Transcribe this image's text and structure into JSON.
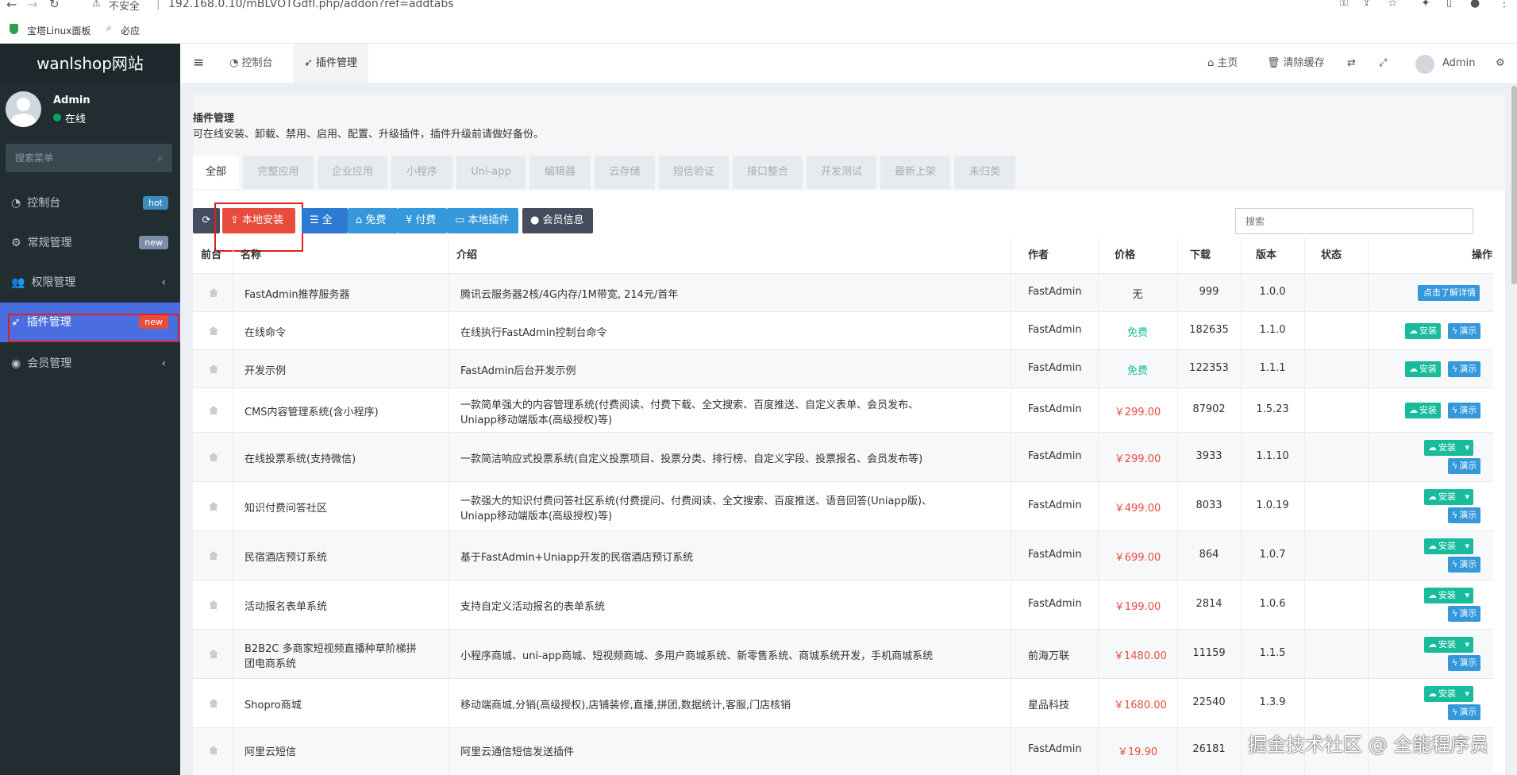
{
  "browser": {
    "security": "不安全",
    "url": "192.168.0.10/mBLVOTGdfl.php/addon?ref=addtabs",
    "bookmarks": [
      "宝塔Linux面板",
      "必应"
    ]
  },
  "sidebar": {
    "brand": "wanlshop网站",
    "user_name": "Admin",
    "status": "在线",
    "search_placeholder": "搜索菜单",
    "items": [
      {
        "label": "控制台",
        "badge": "hot"
      },
      {
        "label": "常规管理",
        "badge": "new"
      },
      {
        "label": "权限管理",
        "badge": ""
      },
      {
        "label": "插件管理",
        "badge": "new"
      },
      {
        "label": "会员管理",
        "badge": ""
      }
    ]
  },
  "header": {
    "tabs": [
      "控制台",
      "插件管理"
    ],
    "home": "主页",
    "clear_cache": "清除缓存",
    "user": "Admin"
  },
  "panel": {
    "title": "插件管理",
    "description": "可在线安装、卸载、禁用、启用、配置、升级插件，插件升级前请做好备份。",
    "categories": [
      "全部",
      "完整应用",
      "企业应用",
      "小程序",
      "Uni-app",
      "编辑器",
      "云存储",
      "短信验证",
      "接口整合",
      "开发测试",
      "最新上架",
      "未归类"
    ],
    "toolbar": {
      "local_install": "本地安装",
      "all": "全部",
      "free": "免费",
      "paid": "付费",
      "local_plugins": "本地插件",
      "member_info": "会员信息",
      "search_placeholder": "搜索"
    },
    "columns": [
      "前台",
      "名称",
      "介绍",
      "作者",
      "价格",
      "下载",
      "版本",
      "状态",
      "操作"
    ],
    "action_labels": {
      "install": "安装",
      "demo": "演示",
      "details": "点击了解详情"
    },
    "rows": [
      {
        "name": "FastAdmin推荐服务器",
        "intro": "腾讯云服务器2核/4G内存/1M带宽, 214元/首年",
        "author": "FastAdmin",
        "price": "无",
        "downloads": "999",
        "version": "1.0.0",
        "action": "details"
      },
      {
        "name": "在线命令",
        "intro": "在线执行FastAdmin控制台命令",
        "author": "FastAdmin",
        "price": "免费",
        "downloads": "182635",
        "version": "1.1.0",
        "action": "inline"
      },
      {
        "name": "开发示例",
        "intro": "FastAdmin后台开发示例",
        "author": "FastAdmin",
        "price": "免费",
        "downloads": "122353",
        "version": "1.1.1",
        "action": "inline"
      },
      {
        "name": "CMS内容管理系统(含小程序)",
        "intro": "一款简单强大的内容管理系统(付费阅读、付费下载、全文搜索、百度推送、自定义表单、会员发布、",
        "intro2": "Uniapp移动端版本(高级授权)等)",
        "author": "FastAdmin",
        "price": "￥299.00",
        "downloads": "87902",
        "version": "1.5.23",
        "action": "inline"
      },
      {
        "name": "在线投票系统(支持微信)",
        "intro": "一款简洁响应式投票系统(自定义投票项目、投票分类、排行榜、自定义字段、投票报名、会员发布等)",
        "author": "FastAdmin",
        "price": "￥299.00",
        "downloads": "3933",
        "version": "1.1.10",
        "action": "stacked"
      },
      {
        "name": "知识付费问答社区",
        "intro": "一款强大的知识付费问答社区系统(付费提问、付费阅读、全文搜索、百度推送、语音回答(Uniapp版)、",
        "intro2": "Uniapp移动端版本(高级授权)等)",
        "author": "FastAdmin",
        "price": "￥499.00",
        "downloads": "8033",
        "version": "1.0.19",
        "action": "stacked"
      },
      {
        "name": "民宿酒店预订系统",
        "intro": "基于FastAdmin+Uniapp开发的民宿酒店预订系统",
        "author": "FastAdmin",
        "price": "￥699.00",
        "downloads": "864",
        "version": "1.0.7",
        "action": "stacked"
      },
      {
        "name": "活动报名表单系统",
        "intro": "支持自定义活动报名的表单系统",
        "author": "FastAdmin",
        "price": "￥199.00",
        "downloads": "2814",
        "version": "1.0.6",
        "action": "stacked"
      },
      {
        "name": "B2B2C 多商家短视频直播种草阶梯拼",
        "name2": "团电商系统",
        "intro": "小程序商城、uni-app商城、短视频商城、多用户商城系统、新零售系统、商城系统开发，手机商城系统",
        "author": "前海万联",
        "price": "￥1480.00",
        "downloads": "11159",
        "version": "1.1.5",
        "action": "stacked"
      },
      {
        "name": "Shopro商城",
        "intro": "移动端商城,分销(高级授权),店铺装修,直播,拼团,数据统计,客服,门店核销",
        "author": "星品科技",
        "price": "￥1680.00",
        "downloads": "22540",
        "version": "1.3.9",
        "action": "stacked"
      },
      {
        "name": "阿里云短信",
        "intro": "阿里云通信短信发送插件",
        "author": "FastAdmin",
        "price": "￥19.90",
        "downloads": "26181",
        "version": "",
        "action": "none"
      }
    ]
  },
  "watermark": "掘金技术社区 @ 全能程序员",
  "colors": {
    "sidebar_bg": "#222d32",
    "highlight": "#e21f1f",
    "active_nav": "#4a6ee0",
    "install_red": "#e74c3c",
    "green": "#18bc9c",
    "blue": "#3498db",
    "dark": "#444c5e"
  }
}
